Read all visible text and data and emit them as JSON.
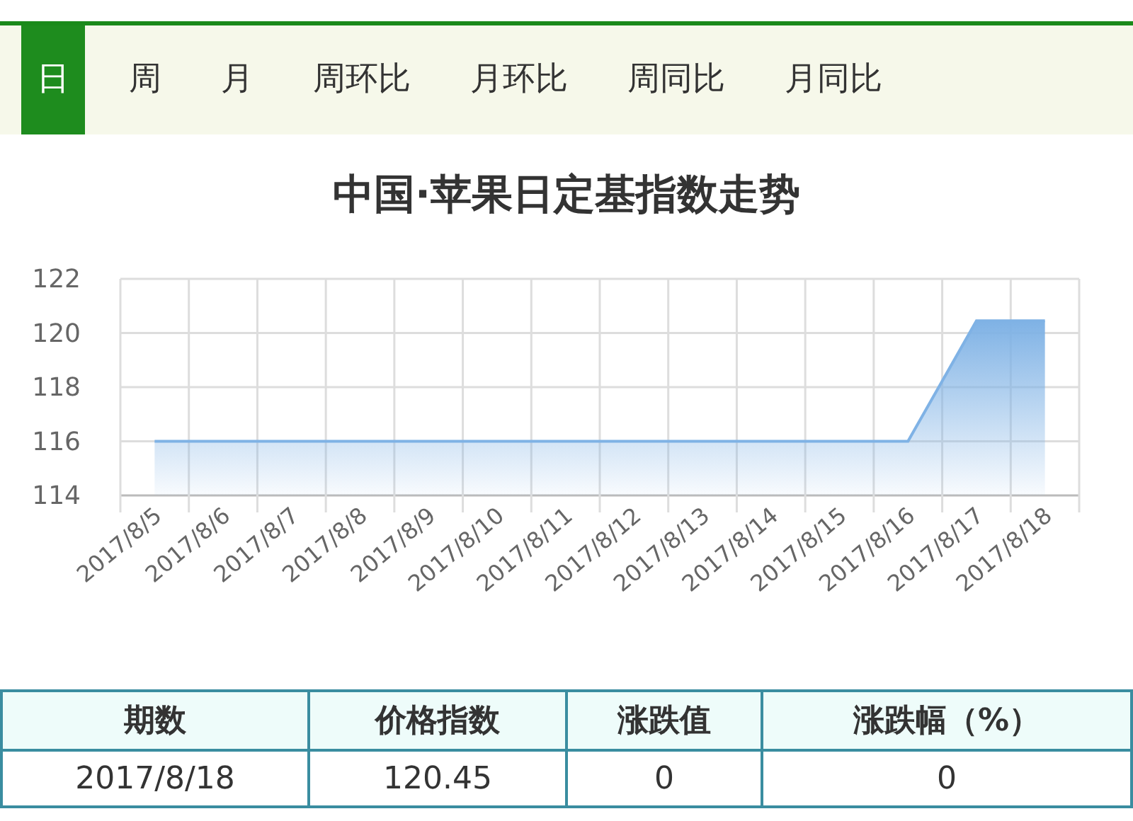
{
  "tabs": [
    {
      "label": "日",
      "selected": true
    },
    {
      "label": "周",
      "selected": false
    },
    {
      "label": "月",
      "selected": false
    },
    {
      "label": "周环比",
      "selected": false
    },
    {
      "label": "月环比",
      "selected": false
    },
    {
      "label": "周同比",
      "selected": false
    },
    {
      "label": "月同比",
      "selected": false
    }
  ],
  "chart": {
    "title": "中国·苹果日定基指数走势",
    "chart_data": {
      "type": "area",
      "categories": [
        "2017/8/5",
        "2017/8/6",
        "2017/8/7",
        "2017/8/8",
        "2017/8/9",
        "2017/8/10",
        "2017/8/11",
        "2017/8/12",
        "2017/8/13",
        "2017/8/14",
        "2017/8/15",
        "2017/8/16",
        "2017/8/17",
        "2017/8/18"
      ],
      "grid": true,
      "series": [
        {
          "color": "#7fb2e5",
          "values": [
            116,
            116,
            116,
            116,
            116,
            116,
            116,
            116,
            116,
            116,
            116,
            116,
            120.45,
            120.45
          ]
        }
      ],
      "ylim": [
        114,
        122
      ],
      "yticks": [
        114,
        116,
        118,
        120,
        122
      ]
    }
  },
  "table": {
    "columns": [
      "期数",
      "价格指数",
      "涨跌值",
      "涨跌幅（%）"
    ],
    "rows": [
      [
        "2017/8/18",
        "120.45",
        "0",
        "0"
      ]
    ]
  }
}
